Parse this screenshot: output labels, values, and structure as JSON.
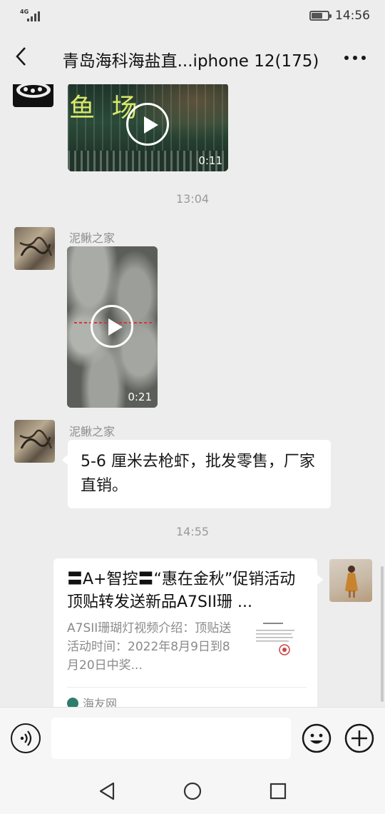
{
  "status_bar": {
    "network": "4G",
    "time": "14:56",
    "battery_level": 0.7
  },
  "header": {
    "title": "青岛海科海盐直...iphone 12(175)",
    "back_icon": "chevron-left-icon",
    "more_icon": "more-dots-icon"
  },
  "chat": {
    "messages": [
      {
        "type": "video",
        "duration": "0:11",
        "overlay_text": "鱼 场"
      },
      {
        "type": "time",
        "text": "13:04"
      },
      {
        "type": "video",
        "sender": "泥鳅之家",
        "duration": "0:21"
      },
      {
        "type": "text",
        "sender": "泥鳅之家",
        "text": "5-6 厘米去枪虾，批发零售，厂家直销。"
      },
      {
        "type": "time",
        "text": "14:55"
      },
      {
        "type": "link",
        "title": "〓A+智控〓“惠在金秋”促销活动顶贴转发送新品A7SII珊 ...",
        "description": "A7SII珊瑚灯视频介绍：顶贴送活动时间：2022年8月9日到8月20日中奖...",
        "source": "海友网"
      }
    ]
  },
  "input_bar": {
    "voice_icon": "voice-icon",
    "emoji_icon": "emoji-icon",
    "plus_icon": "plus-icon",
    "input_value": ""
  },
  "nav_bar": {
    "icons": [
      "nav-back-icon",
      "nav-home-icon",
      "nav-recent-icon"
    ]
  },
  "colors": {
    "background": "#ededed",
    "bubble": "#ffffff",
    "timestamp": "#9a9a9a"
  }
}
